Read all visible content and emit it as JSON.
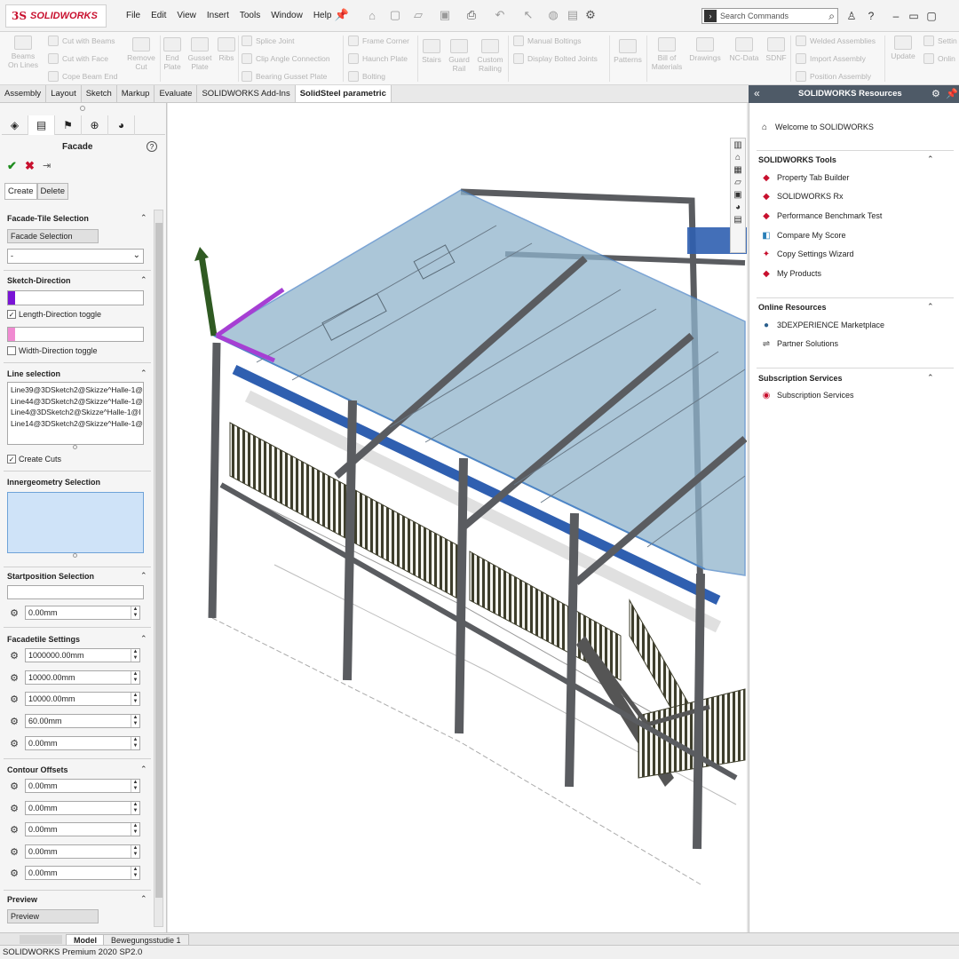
{
  "app": {
    "logo_text": "SOLIDWORKS",
    "logo_prefix": "3S"
  },
  "menu": [
    "File",
    "Edit",
    "View",
    "Insert",
    "Tools",
    "Window",
    "Help"
  ],
  "search": {
    "placeholder": "Search Commands"
  },
  "ribbon": {
    "weldments": [
      {
        "label": "Beams On Lines"
      },
      {
        "label": "Cut with Beams"
      },
      {
        "label": "Cut with Face"
      },
      {
        "label": "Cope Beam End"
      },
      {
        "label": "Remove Cut"
      },
      {
        "label": "End Plate"
      },
      {
        "label": "Gusset Plate"
      },
      {
        "label": "Ribs"
      },
      {
        "label": "Splice Joint"
      },
      {
        "label": "Clip Angle Connection"
      },
      {
        "label": "Bearing Gusset Plate"
      },
      {
        "label": "Frame Corner"
      },
      {
        "label": "Haunch Plate"
      },
      {
        "label": "Bolting"
      },
      {
        "label": "Stairs"
      },
      {
        "label": "Guard Rail"
      },
      {
        "label": "Custom Railing"
      },
      {
        "label": "Manual Boltings"
      },
      {
        "label": "Display Bolted Joints"
      },
      {
        "label": "Patterns"
      },
      {
        "label": "Bill of Materials"
      },
      {
        "label": "Drawings"
      },
      {
        "label": "NC-Data"
      },
      {
        "label": "SDNF"
      },
      {
        "label": "Welded Assemblies"
      },
      {
        "label": "Import Assembly"
      },
      {
        "label": "Position Assembly"
      },
      {
        "label": "Update"
      },
      {
        "label": "Settin"
      },
      {
        "label": "Onlin"
      }
    ]
  },
  "tabs": [
    {
      "label": "Assembly"
    },
    {
      "label": "Layout"
    },
    {
      "label": "Sketch"
    },
    {
      "label": "Markup"
    },
    {
      "label": "Evaluate"
    },
    {
      "label": "SOLIDWORKS Add-Ins"
    },
    {
      "label": "SolidSteel parametric"
    }
  ],
  "property_manager": {
    "title": "Facade",
    "subtabs": [
      "Create",
      "Delete"
    ],
    "facade_tile": {
      "heading": "Facade-Tile Selection",
      "button": "Facade Selection",
      "dropdown_value": "-"
    },
    "sketch_direction": {
      "heading": "Sketch-Direction",
      "length_toggle": "Length-Direction toggle",
      "width_toggle": "Width-Direction toggle"
    },
    "line_selection": {
      "heading": "Line selection",
      "items": [
        "Line39@3DSketch2@Skizze^Halle-1@",
        "Line44@3DSketch2@Skizze^Halle-1@",
        "Line4@3DSketch2@Skizze^Halle-1@I",
        "Line14@3DSketch2@Skizze^Halle-1@"
      ],
      "create_cuts": "Create Cuts"
    },
    "innergeometry": {
      "heading": "Innergeometry Selection"
    },
    "startposition": {
      "heading": "Startposition Selection",
      "value": "0.00mm"
    },
    "facadetile_settings": {
      "heading": "Facadetile Settings",
      "values": [
        "1000000.00mm",
        "10000.00mm",
        "10000.00mm",
        "60.00mm",
        "0.00mm"
      ]
    },
    "contour_offsets": {
      "heading": "Contour Offsets",
      "values": [
        "0.00mm",
        "0.00mm",
        "0.00mm",
        "0.00mm",
        "0.00mm"
      ]
    },
    "preview": {
      "heading": "Preview",
      "button": "Preview"
    }
  },
  "resources": {
    "title": "SOLIDWORKS Resources",
    "welcome": "Welcome to SOLIDWORKS",
    "tools_heading": "SOLIDWORKS Tools",
    "tools": [
      "Property Tab Builder",
      "SOLIDWORKS Rx",
      "Performance Benchmark Test",
      "Compare My Score",
      "Copy Settings Wizard",
      "My Products"
    ],
    "online_heading": "Online Resources",
    "online": [
      "3DEXPERIENCE Marketplace",
      "Partner Solutions"
    ],
    "subscription_heading": "Subscription Services",
    "subscription": [
      "Subscription Services"
    ]
  },
  "bottom_tabs": [
    "Model",
    "Bewegungsstudie 1"
  ],
  "status": {
    "text": "SOLIDWORKS Premium 2020 SP2.0"
  },
  "colors": {
    "accent": "#c8102e",
    "panel_header": "#4e5a67",
    "roof": "#8fb3cc",
    "beam_blue": "#2f5fb0",
    "steel": "#6f7278"
  }
}
